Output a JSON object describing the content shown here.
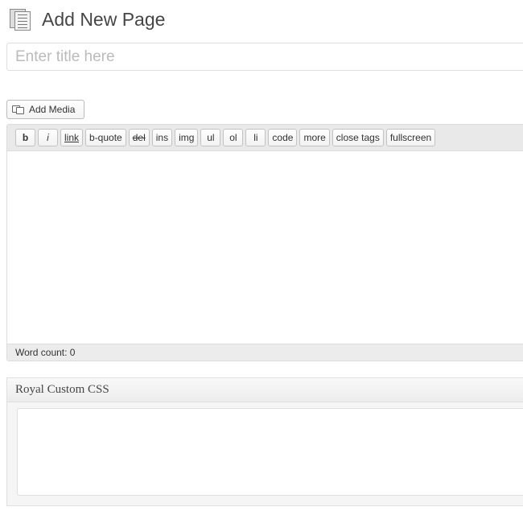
{
  "header": {
    "title": "Add New Page",
    "icon": "pages-icon"
  },
  "title_field": {
    "placeholder": "Enter title here",
    "value": ""
  },
  "media": {
    "add_media_label": "Add Media"
  },
  "toolbar": {
    "buttons": [
      "b",
      "i",
      "link",
      "b-quote",
      "del",
      "ins",
      "img",
      "ul",
      "ol",
      "li",
      "code",
      "more",
      "close tags",
      "fullscreen"
    ]
  },
  "editor": {
    "content": "",
    "word_count_label": "Word count: 0"
  },
  "custom_css_box": {
    "title": "Royal Custom CSS",
    "content": ""
  }
}
